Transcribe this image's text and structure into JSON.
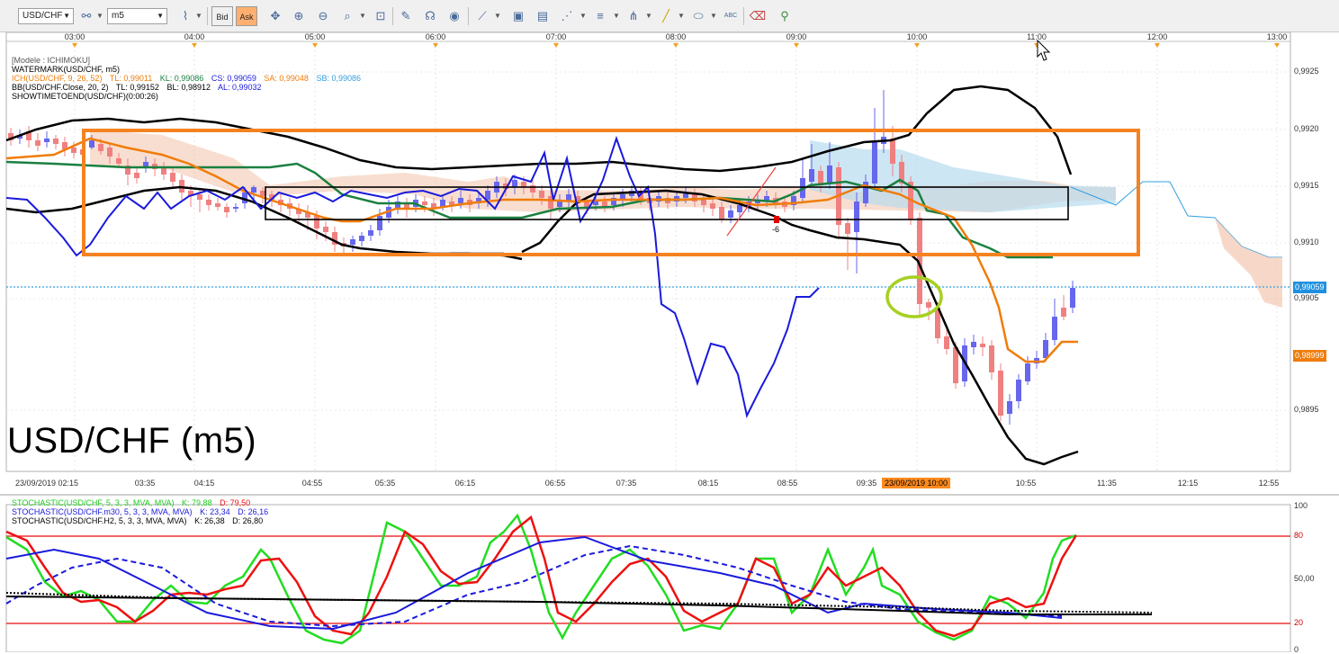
{
  "toolbar": {
    "symbol": "USD/CHF",
    "timeframe": "m5",
    "bid_label": "Bid",
    "ask_label": "Ask",
    "icons": [
      "link-icon",
      "chart-type-icon",
      "crosshair-icon",
      "zoom-in-icon",
      "zoom-out-icon",
      "zoom-fit-icon",
      "zoom-select-icon",
      "indicators-icon",
      "draw-icon",
      "globe-icon",
      "ruler-icon",
      "screenshot-icon",
      "print-icon",
      "fibonacci-icon",
      "lines-icon",
      "pitchfork-icon",
      "trendline-icon",
      "ellipse-icon",
      "text-icon",
      "eraser-icon",
      "network-icon"
    ]
  },
  "main_chart": {
    "top_time_labels": [
      "03:00",
      "04:00",
      "05:00",
      "06:00",
      "07:00",
      "08:00",
      "09:00",
      "10:00",
      "11:00",
      "12:00",
      "13:00"
    ],
    "bottom_time_labels": [
      "23/09/2019 02:15",
      "03:35",
      "04:15",
      "04:55",
      "05:35",
      "06:15",
      "06:55",
      "07:35",
      "08:15",
      "08:55",
      "09:35",
      "10:55",
      "11:35",
      "12:15",
      "12:55"
    ],
    "cursor_time": "23/09/2019 10:00",
    "price_labels": [
      "0,9925",
      "0,9920",
      "0,9915",
      "0,9910",
      "0,9905",
      "0,9895"
    ],
    "current_price": "0,99059",
    "bb_price": "0,98999",
    "legend": {
      "model": "[Modele : ICHIMOKU]",
      "watermark": "WATERMARK(USD/CHF, m5)",
      "ich_name": "ICH(USD/CHF, 9, 26, 52)",
      "ich_tl": "TL: 0,99011",
      "ich_kl": "KL: 0,99086",
      "ich_cs": "CS: 0,99059",
      "ich_sa": "SA: 0,99048",
      "ich_sb": "SB: 0,99086",
      "bb_name": "BB(USD/CHF.Close, 20, 2)",
      "bb_tl": "TL: 0,99152",
      "bb_bl": "BL: 0,98912",
      "bb_al": "AL: 0,99032",
      "showtime": "SHOWTIMETOEND(USD/CHF)(0:00:26)"
    },
    "watermark_text": "USD/CHF (m5)",
    "marker_label": "-6",
    "colors": {
      "bull": "#6666ee",
      "bear": "#f08080",
      "tenkan": "#f07c0a",
      "kijun": "#1a8040",
      "chikou": "#1a1adc",
      "bollinger": "#000000",
      "kumo_up": "#f4c8b0",
      "kumo_down": "#b8dcee",
      "highlight_box": "#f58220",
      "current_price_line": "#33a0e0"
    }
  },
  "stoch_panel": {
    "legend1": "STOCHASTIC(USD/CHF, 5, 3, 3, MVA, MVA)",
    "legend1_k": "K: 79,88",
    "legend1_d": "D: 79,50",
    "legend2": "STOCHASTIC(USD/CHF.m30, 5, 3, 3, MVA, MVA)",
    "legend2_k": "K: 23,34",
    "legend2_d": "D: 26,16",
    "legend3": "STOCHASTIC(USD/CHF.H2, 5, 3, 3, MVA, MVA)",
    "legend3_k": "K: 26,38",
    "legend3_d": "D: 26,80",
    "levels": [
      "100",
      "80",
      "50,00",
      "20",
      "0"
    ],
    "colors": {
      "k_m5": "#22dd22",
      "d_m5": "#ee1111",
      "k_m30": "#1a1adc",
      "d_m30": "#1a1adc",
      "h2": "#000000",
      "level_line": "#ee3333"
    }
  }
}
